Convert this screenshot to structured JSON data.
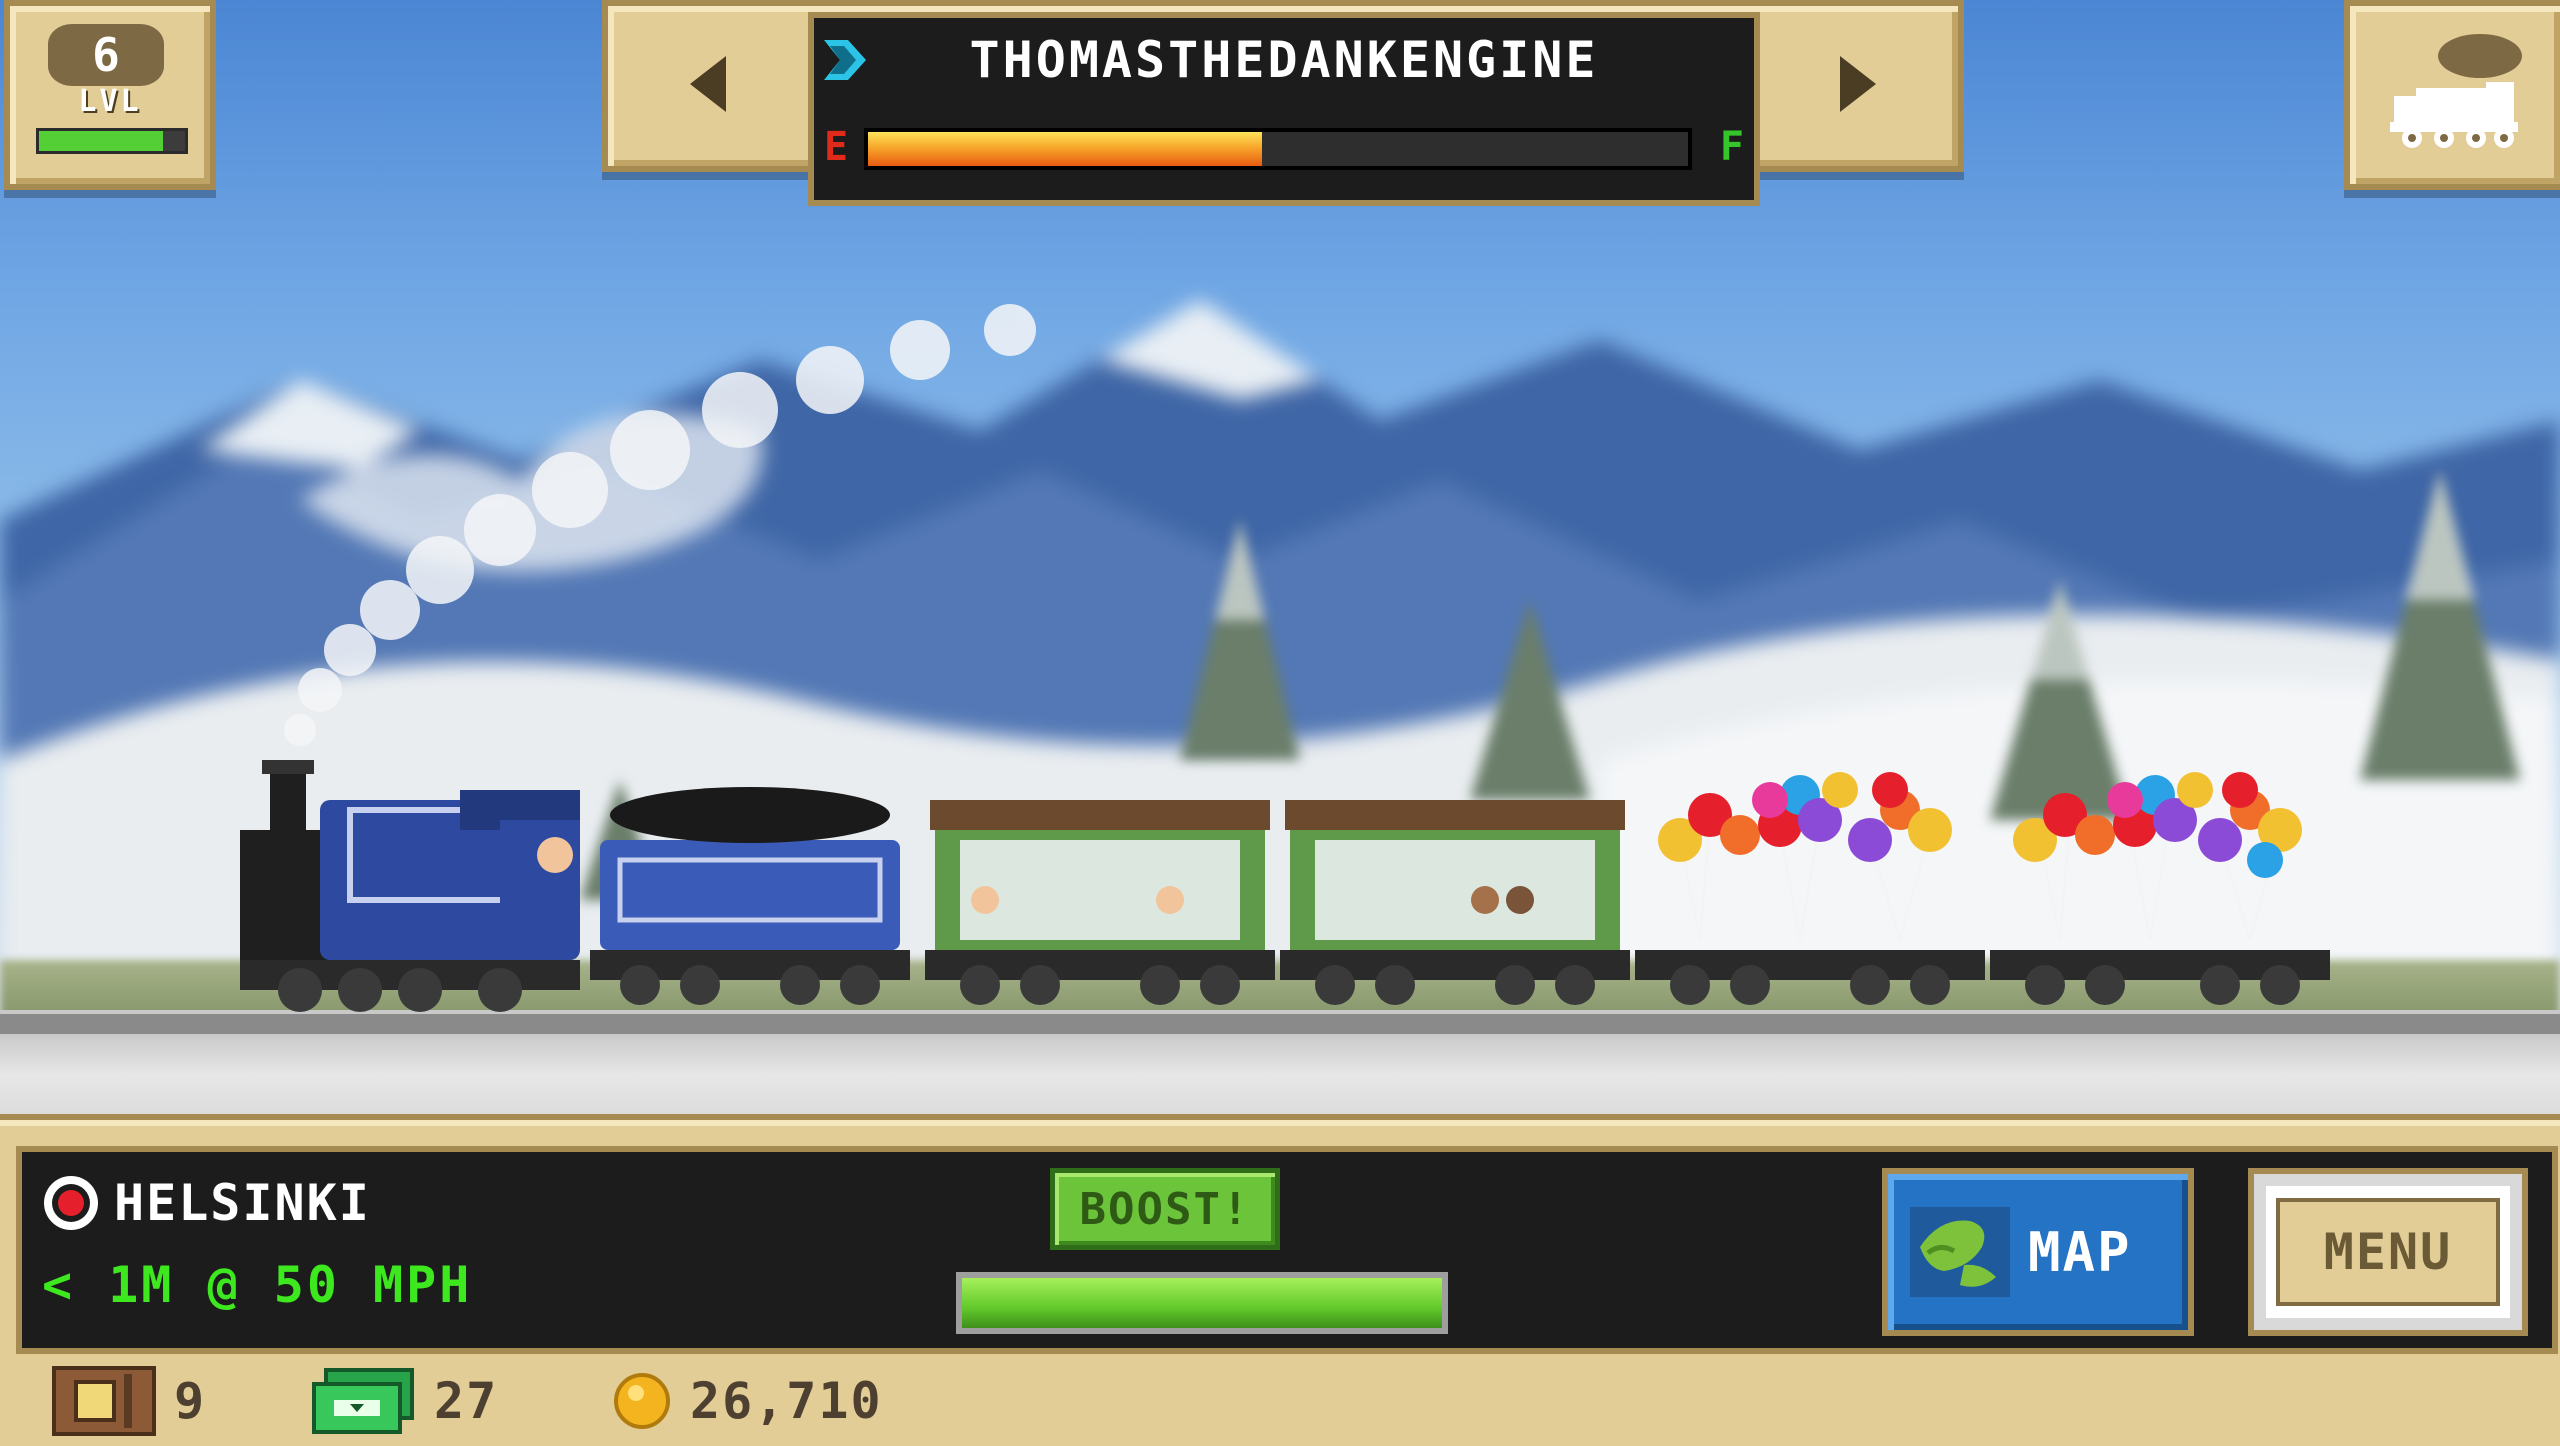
{
  "hud": {
    "level": {
      "value": "6",
      "label": "LVL",
      "progress": 0.85
    },
    "train_name": "THOMASTHEDANKENGINE",
    "fuel": {
      "empty_label": "E",
      "full_label": "F",
      "level": 0.48
    }
  },
  "status": {
    "destination": "HELSINKI",
    "speed_line": "< 1M @ 50 MPH",
    "boost_label": "BOOST!",
    "boost_level": 1.0
  },
  "buttons": {
    "map_label": "MAP",
    "menu_label": "MENU"
  },
  "currency": {
    "crates": "9",
    "cash": "27",
    "coins": "26,710"
  },
  "colors": {
    "panel_tan": "#e2cd97",
    "panel_border": "#a58b52",
    "speed_green": "#3ee81f",
    "boost_green": "#6cc43a",
    "map_blue": "#2573c4",
    "fuel_orange": "#f7a72a",
    "locomotive_blue": "#2e4aa0"
  },
  "icons": {
    "level": "level-badge-icon",
    "train": "train-silhouette-icon",
    "destination": "red-dot-icon",
    "map": "map-icon",
    "crates": "crate-icon",
    "cash": "cash-icon",
    "coins": "coin-icon"
  }
}
